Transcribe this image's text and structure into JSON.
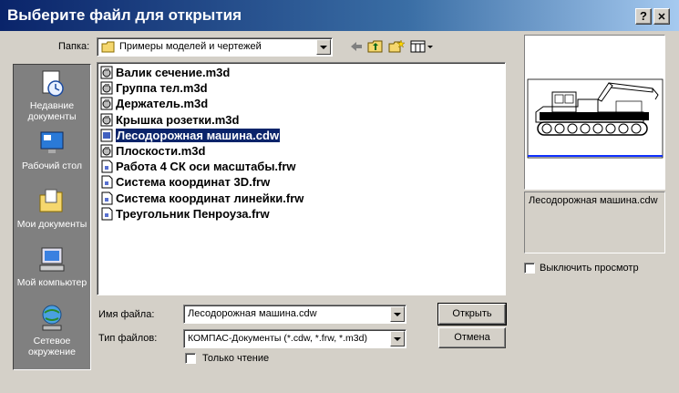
{
  "window": {
    "title": "Выберите файл для открытия",
    "help_button": "?",
    "close_button": "✕"
  },
  "lookin": {
    "label": "Папка:",
    "value": "Примеры моделей и чертежей"
  },
  "places": [
    {
      "label": "Недавние документы",
      "icon": "recent-documents-icon"
    },
    {
      "label": "Рабочий стол",
      "icon": "desktop-icon"
    },
    {
      "label": "Мои документы",
      "icon": "my-documents-icon"
    },
    {
      "label": "Мой компьютер",
      "icon": "my-computer-icon"
    },
    {
      "label": "Сетевое окружение",
      "icon": "network-icon"
    }
  ],
  "files": [
    {
      "name": "Валик сечение.m3d",
      "type": "m3d"
    },
    {
      "name": "Группа тел.m3d",
      "type": "m3d"
    },
    {
      "name": "Держатель.m3d",
      "type": "m3d"
    },
    {
      "name": "Крышка розетки.m3d",
      "type": "m3d"
    },
    {
      "name": "Лесодорожная машина.cdw",
      "type": "cdw",
      "selected": true
    },
    {
      "name": "Плоскости.m3d",
      "type": "m3d"
    },
    {
      "name": "Работа 4 СК оси масштабы.frw",
      "type": "frw"
    },
    {
      "name": "Система координат 3D.frw",
      "type": "frw"
    },
    {
      "name": "Система координат линейки.frw",
      "type": "frw"
    },
    {
      "name": "Треугольник Пенроуза.frw",
      "type": "frw"
    }
  ],
  "filename": {
    "label": "Имя файла:",
    "value": "Лесодорожная машина.cdw"
  },
  "filetype": {
    "label": "Тип файлов:",
    "value": "КОМПАС-Документы (*.cdw, *.frw, *.m3d)"
  },
  "buttons": {
    "open": "Открыть",
    "cancel": "Отмена"
  },
  "readonly": {
    "label": "Только чтение",
    "checked": false
  },
  "preview": {
    "filename": "Лесодорожная машина.cdw",
    "disable_label": "Выключить просмотр",
    "disable_checked": false
  }
}
